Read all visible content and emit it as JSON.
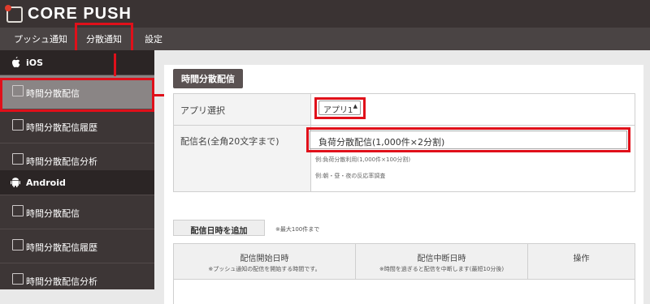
{
  "app": {
    "name": "CORE PUSH"
  },
  "nav": {
    "items": [
      {
        "label": "プッシュ通知"
      },
      {
        "label": "分散通知"
      },
      {
        "label": "設定"
      }
    ]
  },
  "sidebar": {
    "ios": {
      "title": "iOS",
      "items": [
        {
          "label": "時間分散配信",
          "active": true
        },
        {
          "label": "時間分散配信履歴"
        },
        {
          "label": "時間分散配信分析"
        }
      ]
    },
    "android": {
      "title": "Android",
      "items": [
        {
          "label": "時間分散配信"
        },
        {
          "label": "時間分散配信履歴"
        },
        {
          "label": "時間分散配信分析"
        }
      ]
    }
  },
  "main": {
    "section_title": "時間分散配信",
    "app_select": {
      "label": "アプリ選択",
      "value": "アプリ1"
    },
    "delivery_name": {
      "label": "配信名(全角20文字まで)",
      "value": "負荷分散配信(1,000件×2分割)",
      "hint1": "例:負荷分散利用(1,000件×100分割)",
      "hint2": "例:朝・昼・夜の反応率調査"
    },
    "add_button": "配信日時を追加",
    "add_note": "※最大100件まで",
    "table": {
      "columns": [
        {
          "title": "配信開始日時",
          "sub": "※プッシュ通知の配信を開始する時間です。"
        },
        {
          "title": "配信中断日時",
          "sub": "※時間を過ぎると配信を中断します(最短10分後)"
        },
        {
          "title": "操作",
          "sub": ""
        }
      ]
    }
  },
  "colors": {
    "highlight": "#e0101a",
    "topbar": "#3a3333",
    "sidebar": "#3d3636"
  }
}
